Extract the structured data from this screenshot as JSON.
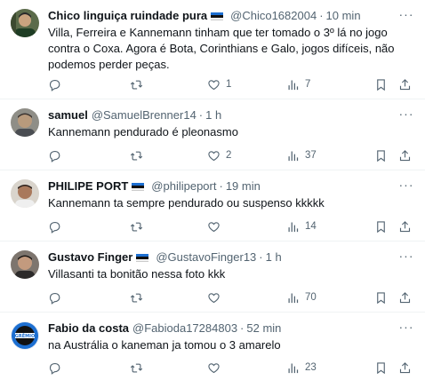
{
  "tweets": [
    {
      "name": "Chico linguiça ruindade pura",
      "handle": "@Chico1682004",
      "time": "10 min",
      "text": "Villa, Ferreira e Kannemann tinham que ter tomado o 3º lá no jogo contra o Coxa. Agora é Bota, Corinthians e Galo, jogos difíceis, não podemos perder peças.",
      "replies": "",
      "retweets": "",
      "likes": "1",
      "views": "7"
    },
    {
      "name": "samuel",
      "handle": "@SamuelBrenner14",
      "time": "1 h",
      "text": "Kannemann pendurado é pleonasmo",
      "replies": "",
      "retweets": "",
      "likes": "2",
      "views": "37"
    },
    {
      "name": "PHILIPE PORT",
      "handle": "@philipeport",
      "time": "19 min",
      "text": "Kannemann ta sempre pendurado ou suspenso kkkkk",
      "replies": "",
      "retweets": "",
      "likes": "",
      "views": "14"
    },
    {
      "name": "Gustavo Finger",
      "handle": "@GustavoFinger13",
      "time": "1 h",
      "text": "Villasanti ta bonitão nessa  foto kkk",
      "replies": "",
      "retweets": "",
      "likes": "",
      "views": "70"
    },
    {
      "name": "Fabio da costa",
      "handle": "@Fabioda17284803",
      "time": "52 min",
      "text": "na Austrália o kaneman ja tomou o 3 amarelo",
      "replies": "",
      "retweets": "",
      "likes": "",
      "views": "23"
    }
  ],
  "avatar_logo_text": "GRÊMIO",
  "colors": {
    "text": "#0f1419",
    "muted": "#536471",
    "divider": "#eff3f4",
    "flag_blue": "#1d6fd1"
  },
  "icons": [
    "reply-icon",
    "retweet-icon",
    "like-icon",
    "views-icon",
    "bookmark-icon",
    "share-icon",
    "more-icon"
  ]
}
